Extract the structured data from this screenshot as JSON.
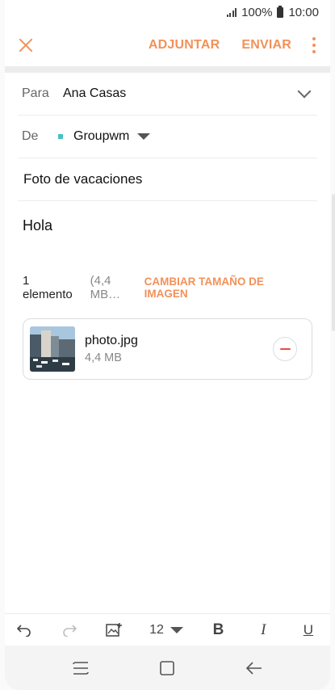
{
  "status": {
    "battery": "100%",
    "time": "10:00"
  },
  "actionbar": {
    "attach": "ADJUNTAR",
    "send": "ENVIAR"
  },
  "compose": {
    "to_label": "Para",
    "to_value": "Ana Casas",
    "from_label": "De",
    "from_value": "Groupwm",
    "subject": "Foto de vacaciones",
    "body": "Hola"
  },
  "attachments": {
    "count": "1 elemento",
    "size_summary": "(4,4 MB…",
    "resize": "CAMBIAR TAMAÑO DE IMAGEN",
    "files": [
      {
        "name": "photo.jpg",
        "size": "4,4 MB"
      }
    ]
  },
  "toolbar": {
    "font_size": "12",
    "bold": "B",
    "italic": "I",
    "underline": "U"
  },
  "icons": [
    "close-icon",
    "more-options-icon",
    "chevron-down-icon",
    "undo-icon",
    "redo-icon",
    "insert-image-icon",
    "remove-icon",
    "recent-apps-icon",
    "home-icon",
    "back-icon"
  ],
  "colors": {
    "accent": "#f2915a",
    "account_dot": "#4bbfc4",
    "remove": "#e44b4b"
  }
}
